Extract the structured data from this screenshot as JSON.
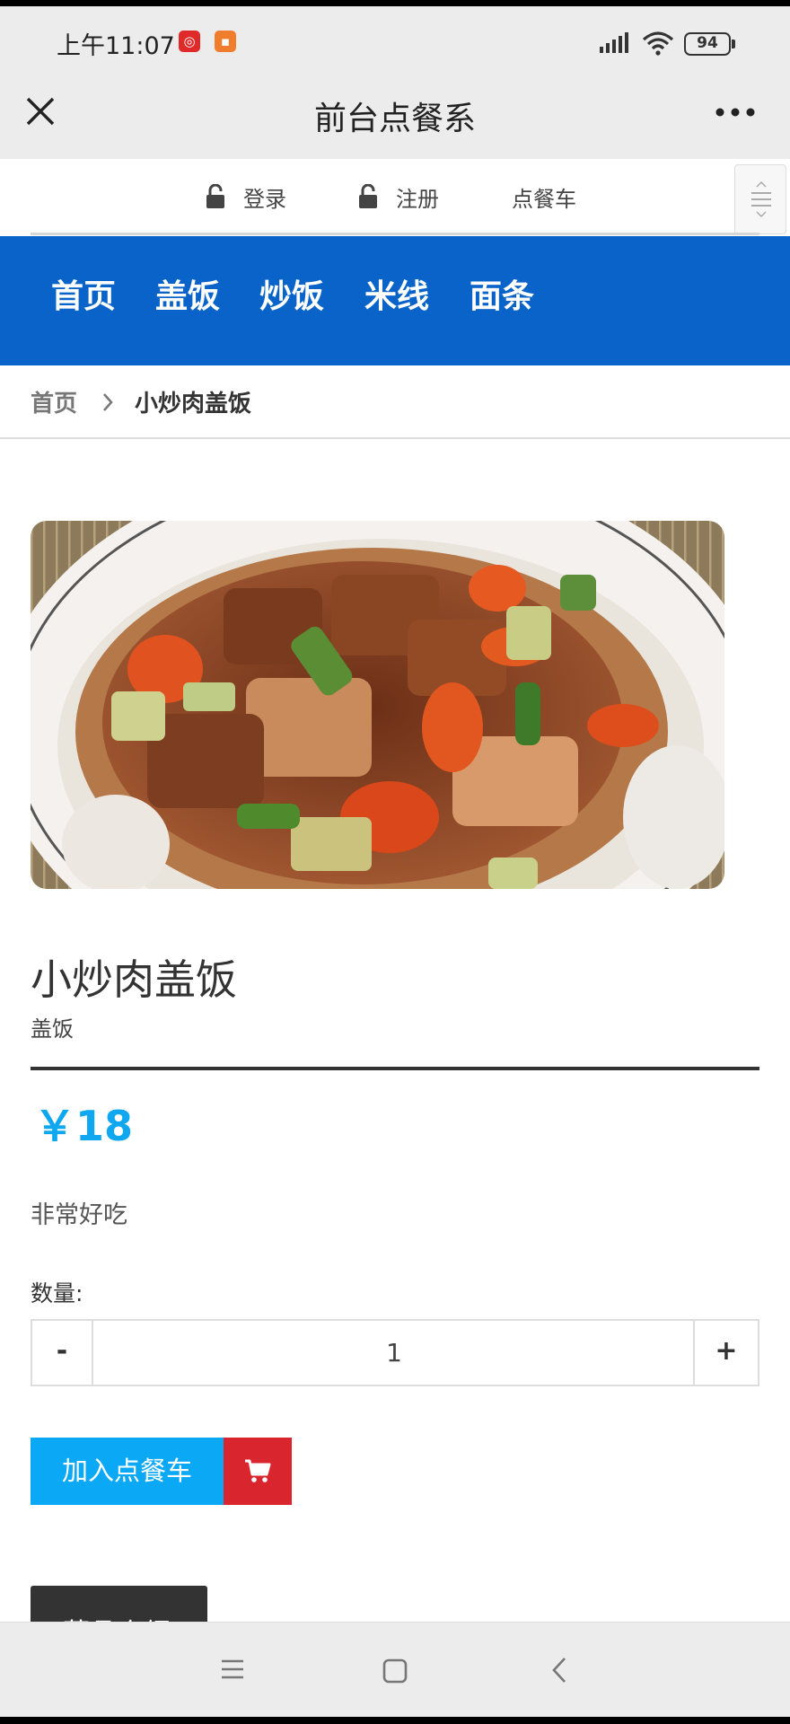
{
  "status_bar": {
    "time": "上午11:07",
    "battery": "94",
    "icons": [
      "netease-music-icon",
      "video-app-icon",
      "signal-icon",
      "wifi-icon",
      "battery-icon"
    ]
  },
  "title_bar": {
    "title": "前台点餐系",
    "close_icon": "close-icon",
    "more_icon": "more-icon"
  },
  "top_links": {
    "login": "登录",
    "register": "注册",
    "cart": "点餐车",
    "icons": [
      "unlock-icon",
      "menu-toggle-icon"
    ]
  },
  "nav": {
    "items": [
      {
        "label": "首页"
      },
      {
        "label": "盖饭"
      },
      {
        "label": "炒饭"
      },
      {
        "label": "米线"
      },
      {
        "label": "面条"
      }
    ],
    "color": "#0a63c9"
  },
  "breadcrumb": {
    "home": "首页",
    "current": "小炒肉盖饭"
  },
  "product": {
    "image_alt": "braised-pork-rice-photo",
    "title": "小炒肉盖饭",
    "category": "盖饭",
    "price": "￥18",
    "price_color": "#0fa7f0",
    "description": "非常好吃",
    "quantity_label": "数量:",
    "quantity": "1",
    "minus": "-",
    "plus": "+",
    "add_to_cart": "加入点餐车",
    "add_color": "#0aa8f5",
    "cart_color": "#d9262e",
    "intro_tab": "菜品介绍"
  },
  "system_nav": {
    "icons": [
      "menu-icon",
      "home-icon",
      "back-icon"
    ]
  }
}
